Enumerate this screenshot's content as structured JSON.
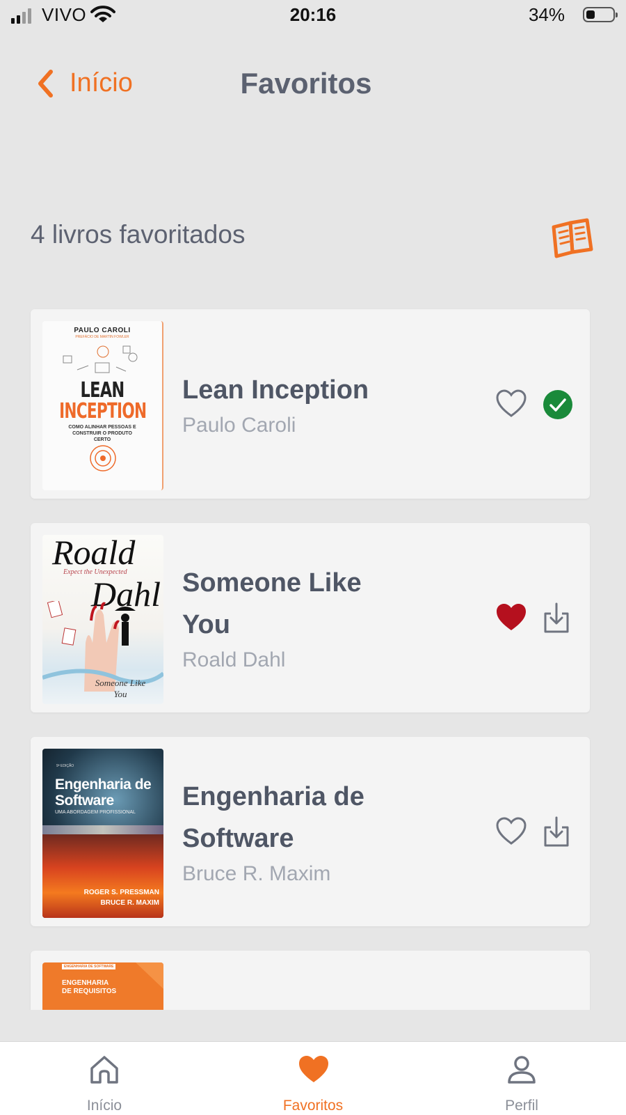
{
  "status_bar": {
    "carrier": "VIVO",
    "time": "20:16",
    "battery_percent": "34%",
    "battery_level": 0.34
  },
  "header": {
    "back_label": "Início",
    "title": "Favoritos"
  },
  "summary": {
    "count_text": "4 livros favoritados"
  },
  "books": [
    {
      "title": "Lean Inception",
      "author": "Paulo Caroli",
      "favorited": false,
      "status": "downloaded",
      "cover": {
        "author": "PAULO CAROLI",
        "subtitle": "PREFÁCIO DE MARTIN FOWLER",
        "title_line1": "LEAN",
        "title_line2": "INCEPTION",
        "tagline": "COMO ALINHAR PESSOAS E CONSTRUIR O PRODUTO CERTO"
      }
    },
    {
      "title": "Someone Like You",
      "author": "Roald Dahl",
      "favorited": true,
      "status": "download",
      "cover": {
        "author_first": "Roald",
        "tagline": "Expect the Unexpected",
        "author_last": "Dahl",
        "title": "Someone Like You"
      }
    },
    {
      "title": "Engenharia de Software",
      "author": "Bruce R. Maxim",
      "favorited": false,
      "status": "download",
      "cover": {
        "edition": "9ª EDIÇÃO",
        "title": "Engenharia de Software",
        "subtitle": "UMA ABORDAGEM PROFISSIONAL",
        "authors": "ROGER S. PRESSMAN BRUCE R. MAXIM"
      }
    },
    {
      "cover": {
        "tag": "ENGENHARIA DE SOFTWARE",
        "title": "ENGENHARIA DE REQUISITOS"
      }
    }
  ],
  "tabs": [
    {
      "label": "Início",
      "icon": "home-icon",
      "active": false
    },
    {
      "label": "Favoritos",
      "icon": "heart-icon",
      "active": true
    },
    {
      "label": "Perfil",
      "icon": "person-icon",
      "active": false
    }
  ],
  "colors": {
    "accent": "#f07123",
    "favorite_red": "#b5101e",
    "downloaded_green": "#1a8a3a",
    "background": "#e6e6e6",
    "card": "#f4f4f4"
  }
}
